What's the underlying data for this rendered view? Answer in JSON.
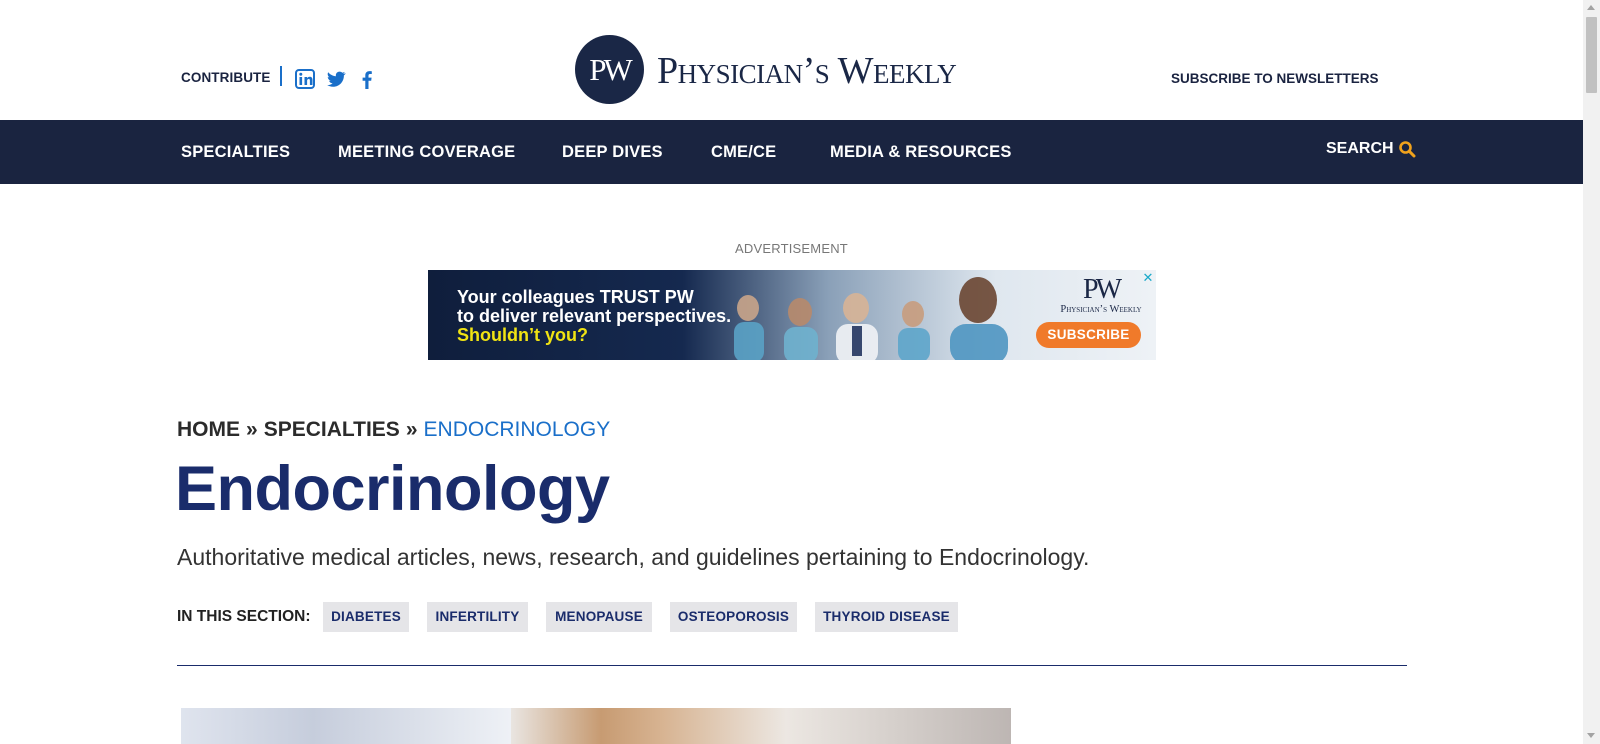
{
  "header": {
    "contribute_label": "CONTRIBUTE",
    "social": [
      {
        "icon": "linkedin-icon",
        "color": "#1a6fc9"
      },
      {
        "icon": "twitter-icon",
        "color": "#1a6fc9"
      },
      {
        "icon": "facebook-icon",
        "color": "#1a6fc9"
      }
    ],
    "logo": {
      "mark": "PW",
      "wordmark": "Physician’s Weekly"
    },
    "subscribe_label": "SUBSCRIBE TO NEWSLETTERS"
  },
  "nav": {
    "background": "#1a2440",
    "items": [
      {
        "label": "SPECIALTIES"
      },
      {
        "label": "MEETING COVERAGE"
      },
      {
        "label": "DEEP DIVES"
      },
      {
        "label": "CME/CE"
      },
      {
        "label": "MEDIA & RESOURCES"
      }
    ],
    "search_label": "SEARCH",
    "search_icon_color": "#f0a21c"
  },
  "ad": {
    "label": "ADVERTISEMENT",
    "line1": "Your colleagues TRUST PW",
    "line2": "to deliver relevant perspectives.",
    "line3": "Shouldn’t you?",
    "logo_mark": "PW",
    "logo_name": "Physician’s Weekly",
    "cta": "SUBSCRIBE",
    "close": "✕"
  },
  "breadcrumb": {
    "home": "HOME",
    "specialties": "SPECIALTIES",
    "separator": "»",
    "current": "ENDOCRINOLOGY"
  },
  "page": {
    "title": "Endocrinology",
    "description": "Authoritative medical articles, news, research, and guidelines pertaining to Endocrinology."
  },
  "section": {
    "label": "IN THIS SECTION:",
    "tags": [
      {
        "label": "DIABETES"
      },
      {
        "label": "INFERTILITY"
      },
      {
        "label": "MENOPAUSE"
      },
      {
        "label": "OSTEOPOROSIS"
      },
      {
        "label": "THYROID DISEASE"
      }
    ]
  },
  "colors": {
    "accent": "#1a6fc9",
    "title": "#1a2c6b",
    "brand_dark": "#1a2746"
  }
}
